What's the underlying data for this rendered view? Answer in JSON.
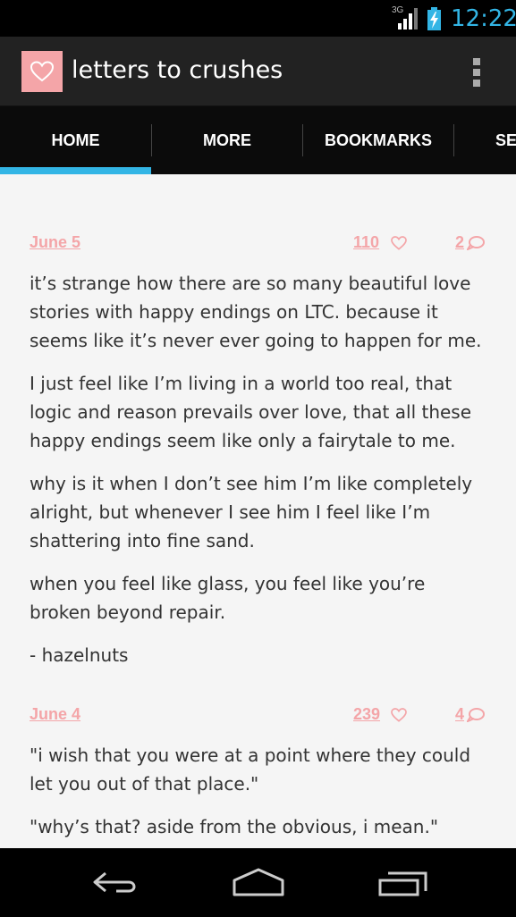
{
  "status_bar": {
    "network": "3G",
    "time": "12:22"
  },
  "action_bar": {
    "title": "letters to crushes",
    "app_icon": "heart-icon",
    "overflow_icon": "overflow-menu-icon"
  },
  "tabs": [
    {
      "label": "HOME",
      "selected": true
    },
    {
      "label": "MORE",
      "selected": false
    },
    {
      "label": "BOOKMARKS",
      "selected": false
    },
    {
      "label": "SE",
      "selected": false
    }
  ],
  "accent_color": "#33b5e5",
  "brand_color": "#f4a5a8",
  "posts": [
    {
      "date": "June 5",
      "likes": "110",
      "comments": "2",
      "paragraphs": [
        "it’s strange how there are so many beautiful love stories with happy endings on LTC. because it seems like it’s never ever going to happen for me.",
        "I just feel like I’m living in a world too real, that logic and reason prevails over love, that all these happy endings seem like only a fairytale to me.",
        "why is it when I don’t see him I’m like completely alright, but whenever I see him I feel like I’m shattering into fine sand.",
        "when you feel like glass, you feel like you’re broken beyond repair.",
        "- hazelnuts"
      ]
    },
    {
      "date": "June 4",
      "likes": "239",
      "comments": "4",
      "paragraphs": [
        "\"i wish that you were at a point where they could let you out of that place.\"",
        "\"why’s that? aside from the obvious, i mean.\""
      ]
    }
  ],
  "nav_bar": {
    "back_icon": "back-icon",
    "home_icon": "home-icon",
    "recents_icon": "recent-apps-icon"
  }
}
